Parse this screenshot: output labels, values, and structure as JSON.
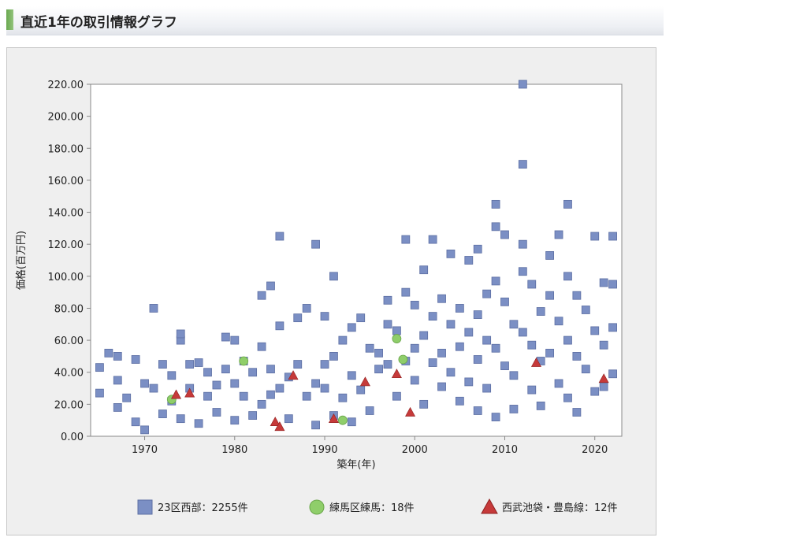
{
  "header": {
    "title": "直近1年の取引情報グラフ"
  },
  "colors": {
    "series_0": "#7b8fc4",
    "series_1": "#8fce6a",
    "series_2": "#c63a3a",
    "plot_bg": "#ffffff",
    "panel_bg": "#efefef"
  },
  "chart_data": {
    "type": "scatter",
    "title": "",
    "xlabel": "築年(年)",
    "ylabel": "価格(百万円)",
    "xlim": [
      1964,
      2023
    ],
    "ylim": [
      0,
      220
    ],
    "x_ticks": [
      1970,
      1980,
      1990,
      2000,
      2010,
      2020
    ],
    "y_ticks": [
      "0.00",
      "20.00",
      "40.00",
      "60.00",
      "80.00",
      "100.00",
      "120.00",
      "140.00",
      "160.00",
      "180.00",
      "200.00",
      "220.00"
    ],
    "grid": false,
    "legend_position": "bottom",
    "series": [
      {
        "name": "23区西部：2255件",
        "marker": "square",
        "note_count": 2255,
        "points": [
          [
            1965,
            27
          ],
          [
            1965,
            43
          ],
          [
            1966,
            52
          ],
          [
            1967,
            50
          ],
          [
            1967,
            35
          ],
          [
            1967,
            18
          ],
          [
            1968,
            24
          ],
          [
            1969,
            9
          ],
          [
            1969,
            48
          ],
          [
            1970,
            4
          ],
          [
            1970,
            33
          ],
          [
            1971,
            30
          ],
          [
            1971,
            80
          ],
          [
            1972,
            45
          ],
          [
            1972,
            14
          ],
          [
            1973,
            22
          ],
          [
            1973,
            38
          ],
          [
            1974,
            60
          ],
          [
            1974,
            64
          ],
          [
            1974,
            11
          ],
          [
            1975,
            45
          ],
          [
            1975,
            30
          ],
          [
            1976,
            8
          ],
          [
            1976,
            46
          ],
          [
            1977,
            25
          ],
          [
            1977,
            40
          ],
          [
            1978,
            15
          ],
          [
            1978,
            32
          ],
          [
            1979,
            62
          ],
          [
            1979,
            42
          ],
          [
            1980,
            10
          ],
          [
            1980,
            33
          ],
          [
            1980,
            60
          ],
          [
            1981,
            25
          ],
          [
            1981,
            47
          ],
          [
            1982,
            13
          ],
          [
            1982,
            40
          ],
          [
            1983,
            88
          ],
          [
            1983,
            56
          ],
          [
            1983,
            20
          ],
          [
            1984,
            94
          ],
          [
            1984,
            42
          ],
          [
            1984,
            26
          ],
          [
            1985,
            69
          ],
          [
            1985,
            30
          ],
          [
            1985,
            125
          ],
          [
            1986,
            37
          ],
          [
            1986,
            11
          ],
          [
            1987,
            74
          ],
          [
            1987,
            45
          ],
          [
            1988,
            80
          ],
          [
            1988,
            25
          ],
          [
            1989,
            120
          ],
          [
            1989,
            33
          ],
          [
            1989,
            7
          ],
          [
            1990,
            75
          ],
          [
            1990,
            45
          ],
          [
            1990,
            30
          ],
          [
            1991,
            100
          ],
          [
            1991,
            50
          ],
          [
            1991,
            13
          ],
          [
            1992,
            60
          ],
          [
            1992,
            24
          ],
          [
            1993,
            68
          ],
          [
            1993,
            38
          ],
          [
            1993,
            9
          ],
          [
            1994,
            74
          ],
          [
            1994,
            29
          ],
          [
            1995,
            55
          ],
          [
            1995,
            16
          ],
          [
            1996,
            52
          ],
          [
            1996,
            42
          ],
          [
            1997,
            85
          ],
          [
            1997,
            70
          ],
          [
            1997,
            45
          ],
          [
            1998,
            66
          ],
          [
            1998,
            25
          ],
          [
            1999,
            123
          ],
          [
            1999,
            90
          ],
          [
            1999,
            47
          ],
          [
            2000,
            82
          ],
          [
            2000,
            55
          ],
          [
            2000,
            35
          ],
          [
            2001,
            104
          ],
          [
            2001,
            63
          ],
          [
            2001,
            20
          ],
          [
            2002,
            123
          ],
          [
            2002,
            75
          ],
          [
            2002,
            46
          ],
          [
            2003,
            86
          ],
          [
            2003,
            52
          ],
          [
            2003,
            31
          ],
          [
            2004,
            114
          ],
          [
            2004,
            70
          ],
          [
            2004,
            40
          ],
          [
            2005,
            80
          ],
          [
            2005,
            56
          ],
          [
            2005,
            22
          ],
          [
            2006,
            110
          ],
          [
            2006,
            65
          ],
          [
            2006,
            34
          ],
          [
            2007,
            117
          ],
          [
            2007,
            76
          ],
          [
            2007,
            48
          ],
          [
            2007,
            16
          ],
          [
            2008,
            89
          ],
          [
            2008,
            60
          ],
          [
            2008,
            30
          ],
          [
            2009,
            145
          ],
          [
            2009,
            131
          ],
          [
            2009,
            97
          ],
          [
            2009,
            55
          ],
          [
            2009,
            12
          ],
          [
            2010,
            126
          ],
          [
            2010,
            84
          ],
          [
            2010,
            44
          ],
          [
            2011,
            70
          ],
          [
            2011,
            38
          ],
          [
            2011,
            17
          ],
          [
            2012,
            220
          ],
          [
            2012,
            170
          ],
          [
            2012,
            120
          ],
          [
            2012,
            103
          ],
          [
            2012,
            65
          ],
          [
            2013,
            95
          ],
          [
            2013,
            57
          ],
          [
            2013,
            29
          ],
          [
            2014,
            78
          ],
          [
            2014,
            47
          ],
          [
            2014,
            19
          ],
          [
            2015,
            113
          ],
          [
            2015,
            88
          ],
          [
            2015,
            52
          ],
          [
            2016,
            126
          ],
          [
            2016,
            72
          ],
          [
            2016,
            33
          ],
          [
            2017,
            145
          ],
          [
            2017,
            100
          ],
          [
            2017,
            60
          ],
          [
            2017,
            24
          ],
          [
            2018,
            88
          ],
          [
            2018,
            50
          ],
          [
            2018,
            15
          ],
          [
            2019,
            79
          ],
          [
            2019,
            42
          ],
          [
            2020,
            125
          ],
          [
            2020,
            66
          ],
          [
            2020,
            28
          ],
          [
            2021,
            96
          ],
          [
            2021,
            57
          ],
          [
            2021,
            31
          ],
          [
            2022,
            125
          ],
          [
            2022,
            95
          ],
          [
            2022,
            68
          ],
          [
            2022,
            39
          ]
        ]
      },
      {
        "name": "練馬区練馬：18件",
        "marker": "circle",
        "note_count": 18,
        "points": [
          [
            1973,
            23
          ],
          [
            1981,
            47
          ],
          [
            1992,
            10
          ],
          [
            1998,
            61
          ],
          [
            1998.7,
            48
          ]
        ]
      },
      {
        "name": "西武池袋・豊島線：12件",
        "marker": "triangle",
        "note_count": 12,
        "points": [
          [
            1973.5,
            26
          ],
          [
            1975,
            27
          ],
          [
            1984.5,
            9
          ],
          [
            1985,
            6
          ],
          [
            1986.5,
            38
          ],
          [
            1991,
            11
          ],
          [
            1994.5,
            34
          ],
          [
            1998,
            39
          ],
          [
            1999.5,
            15
          ],
          [
            2013.5,
            46
          ],
          [
            2021,
            36
          ]
        ]
      }
    ]
  }
}
